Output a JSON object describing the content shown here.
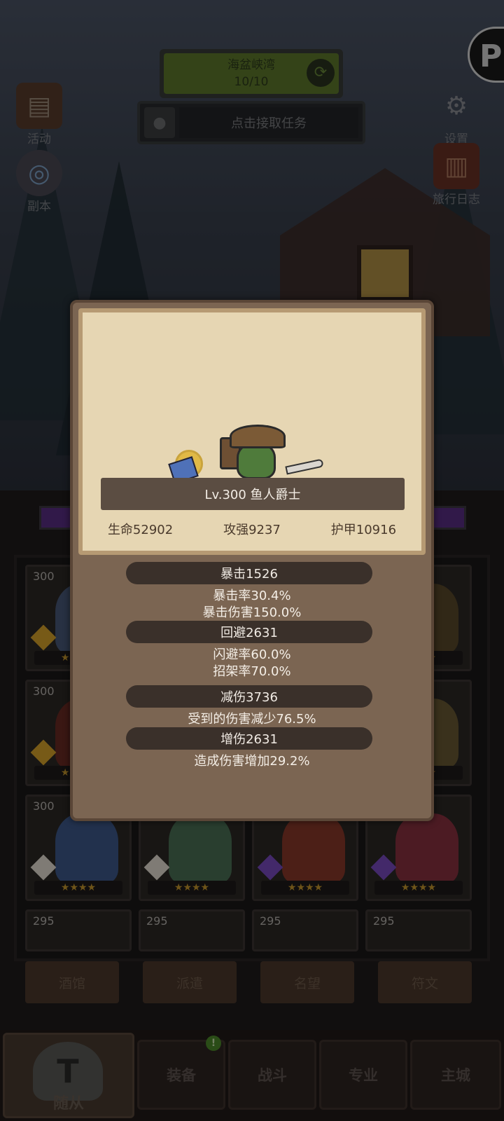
{
  "top": {
    "zone_name": "海盆峡湾",
    "zone_progress": "10/10",
    "refresh_icon": "refresh-icon",
    "quest_label": "点击接取任务",
    "quest_icon": "microphone-icon"
  },
  "side_left": [
    {
      "label": "活动",
      "icon": "book-icon"
    },
    {
      "label": "副本",
      "icon": "portal-icon"
    }
  ],
  "side_right": [
    {
      "label": "设置",
      "icon": "gear-icon"
    },
    {
      "label": "旅行日志",
      "icon": "journal-icon"
    }
  ],
  "roster": [
    {
      "level": "300",
      "gem": "#d9a52a"
    },
    {
      "level": "300",
      "gem": "#d9a52a"
    },
    {
      "level": "300",
      "gem": "#d9a52a"
    },
    {
      "level": "300",
      "gem": "#d9a52a"
    },
    {
      "level": "300",
      "gem": "#e8e0d6"
    },
    {
      "level": "300",
      "gem": "#e8e0d6"
    },
    {
      "level": "300",
      "gem": "#7b4cc2"
    },
    {
      "level": "300",
      "gem": "#7b4cc2"
    },
    {
      "level": "295"
    },
    {
      "level": "295"
    },
    {
      "level": "295"
    },
    {
      "level": "295"
    }
  ],
  "sub_tabs": [
    "酒馆",
    "派遣",
    "名望",
    "符文"
  ],
  "bottom_nav": {
    "active": "随从",
    "tabs": [
      "装备",
      "战斗",
      "专业",
      "主城"
    ],
    "alert": "!"
  },
  "popup": {
    "hero_name": "Lv.300 鱼人爵士",
    "hp": "生命52902",
    "attack": "攻强9237",
    "armor": "护甲10916",
    "sections": [
      {
        "title": "暴击1526",
        "lines": [
          "暴击率30.4%",
          "暴击伤害150.0%"
        ]
      },
      {
        "title": "回避2631",
        "lines": [
          "闪避率60.0%",
          "招架率70.0%"
        ]
      },
      {
        "title": "减伤3736",
        "lines": [
          "受到的伤害减少76.5%"
        ]
      },
      {
        "title": "增伤2631",
        "lines": [
          "造成伤害增加29.2%"
        ]
      }
    ]
  },
  "colors": {
    "popup_bg": "#7b6552",
    "parchment": "#e6d6b3",
    "pill": "#3a302a",
    "zone_green": "#5f7a2c"
  }
}
